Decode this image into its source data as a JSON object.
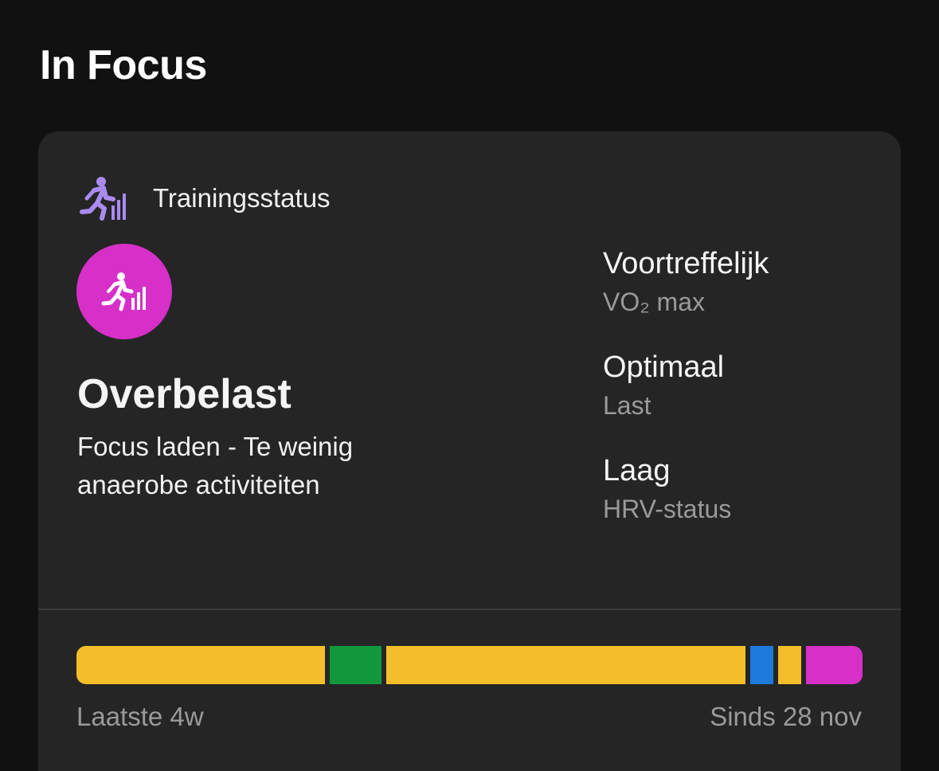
{
  "section": {
    "title": "In Focus"
  },
  "card": {
    "header": {
      "label": "Trainingsstatus",
      "icon": "training-status-icon"
    },
    "status": {
      "icon": "training-status-icon",
      "color": "#D630C8",
      "title": "Overbelast",
      "description": "Focus laden - Te weinig anaerobe activiteiten"
    },
    "metrics": [
      {
        "value": "Voortreffelijk",
        "label": "VO₂ max"
      },
      {
        "value": "Optimaal",
        "label": "Last"
      },
      {
        "value": "Laag",
        "label": "HRV-status"
      }
    ],
    "history": {
      "segments": [
        {
          "color": "#F4BE2A",
          "weight": 313
        },
        {
          "color": "#13973D",
          "weight": 65
        },
        {
          "color": "#F4BE2A",
          "weight": 452
        },
        {
          "color": "#1E7BDB",
          "weight": 29
        },
        {
          "color": "#F4BE2A",
          "weight": 29
        },
        {
          "color": "#D630C8",
          "weight": 71
        }
      ],
      "start_label": "Laatste 4w",
      "end_label": "Sinds 28 nov"
    }
  },
  "colors": {
    "background": "#111111",
    "card": "#252525",
    "accent_icon": "#A98BF0",
    "muted_text": "#9A9A9A"
  }
}
